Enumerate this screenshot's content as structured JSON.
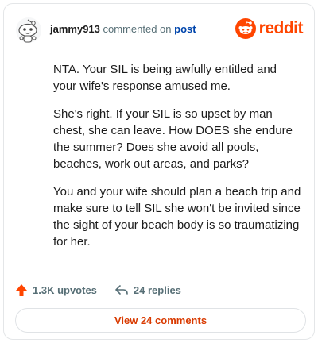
{
  "header": {
    "username": "jammy913",
    "verb": "commented on",
    "post_link": "post",
    "brand": "reddit"
  },
  "comment": {
    "paragraphs": [
      "NTA. Your SIL is being awfully entitled and your wife's response amused me.",
      "She's right. If your SIL is so upset by man chest, she can leave. How DOES she endure the summer? Does she avoid all pools, beaches, work out areas, and parks?",
      "You and your wife should plan a beach trip and make sure to tell SIL she won't be invited since the sight of your beach body is so traumatizing for her."
    ]
  },
  "actions": {
    "upvotes": "1.3K upvotes",
    "replies": "24 replies"
  },
  "footer": {
    "view_comments": "View 24 comments"
  },
  "colors": {
    "brand": "#ff4500",
    "link": "#0045ac",
    "button_text": "#d93a00"
  }
}
